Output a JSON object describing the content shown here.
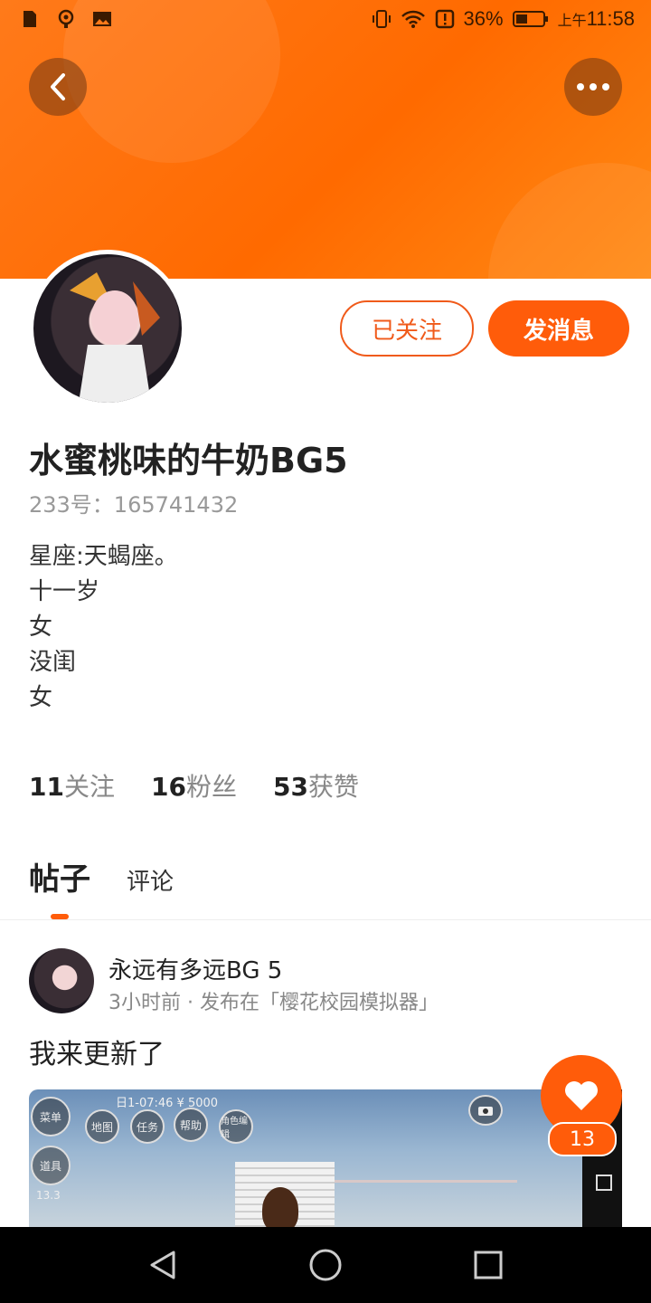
{
  "status_bar": {
    "battery": "36%",
    "time_prefix": "上午",
    "time": "11:58"
  },
  "profile": {
    "name": "水蜜桃味的牛奶BG5",
    "uid": "233号：165741432",
    "bio": [
      "星座:天蝎座。",
      "十一岁",
      "女",
      "没闺",
      "女"
    ],
    "follow_button": "已关注",
    "message_button": "发消息"
  },
  "stats": [
    {
      "num": "11",
      "label": "关注"
    },
    {
      "num": "16",
      "label": "粉丝"
    },
    {
      "num": "53",
      "label": "获赞"
    }
  ],
  "tabs": {
    "active": "帖子",
    "other": "评论"
  },
  "post": {
    "user": "永远有多远BG 5",
    "meta": "3小时前 · 发布在「樱花校园模拟器」",
    "text": "我来更新了",
    "game_info": "日1-07:46 ¥ 5000",
    "game_buttons": [
      "菜单",
      "地图",
      "任务",
      "帮助",
      "角色编辑",
      "道具"
    ],
    "game_level": "13.3"
  },
  "like_count": "13",
  "colors": {
    "accent": "#ff5c0a",
    "header": "#ff7a1a"
  }
}
